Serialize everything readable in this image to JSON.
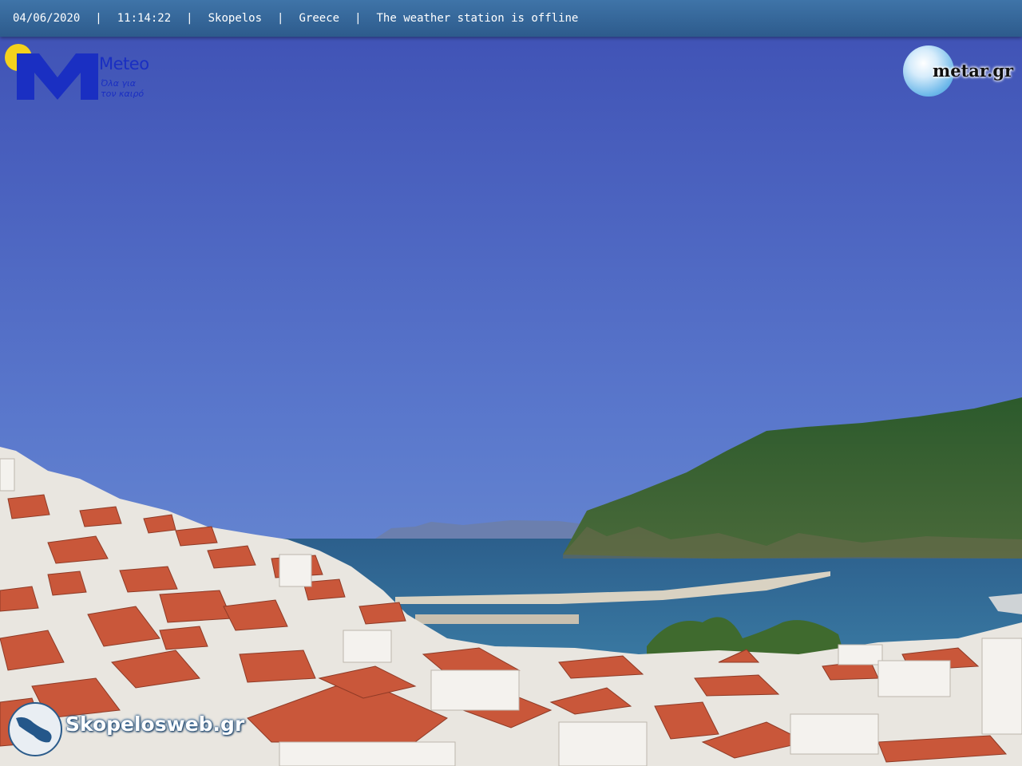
{
  "header": {
    "date": "04/06/2020",
    "time": "11:14:22",
    "location": "Skopelos",
    "country": "Greece",
    "status": "The weather station is offline",
    "separator": "|"
  },
  "logos": {
    "meteo": {
      "brand": "Meteo",
      "tagline_1": "Όλα για",
      "tagline_2": "τον καιρό"
    },
    "metar": {
      "text": "metar.gr"
    },
    "skopelosweb": {
      "text": "Skopelosweb.gr"
    }
  },
  "colors": {
    "sky_top": "#3e50b4",
    "sky_horizon": "#6f90d4",
    "sea": "#2f6a95",
    "hill": "#2e5a2c",
    "roof": "#c9573a",
    "meteo_blue": "#1a2fc2",
    "meteo_sun": "#f4d21c",
    "header_bar": "#33669a"
  }
}
